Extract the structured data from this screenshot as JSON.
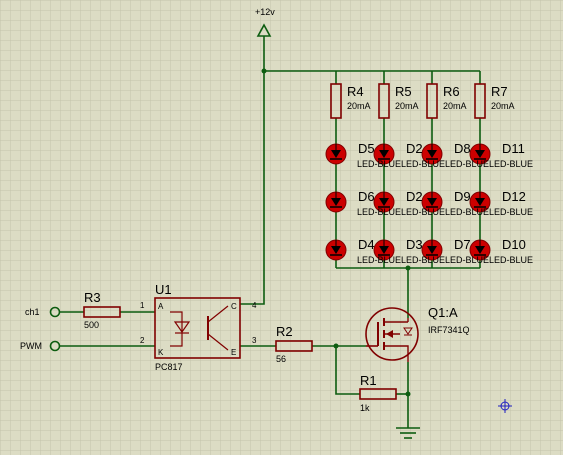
{
  "supply": {
    "label": "+12v"
  },
  "resistors_top": [
    {
      "name": "R4",
      "value": "20mA"
    },
    {
      "name": "R5",
      "value": "20mA"
    },
    {
      "name": "R6",
      "value": "20mA"
    },
    {
      "name": "R7",
      "value": "20mA"
    }
  ],
  "led_rows": [
    {
      "labels": [
        "D5",
        "D2",
        "D8",
        "D11"
      ],
      "type": "LED-BLUE",
      "overlap_text": "LED-BLUELED-BLUELED-BLUELED-BLUE"
    },
    {
      "labels": [
        "D6",
        "D2",
        "D9",
        "D12"
      ],
      "type": "LED-BLUE",
      "overlap_text": "LED-BLUELED-BLUELED-BLUELED-BLUE"
    },
    {
      "labels": [
        "D4",
        "D3",
        "D7",
        "D10"
      ],
      "type": "LED-BLUE",
      "overlap_text": "LED-BLUELED-BLUELED-BLUELED-BLUE"
    }
  ],
  "inputs": {
    "ch1": "ch1",
    "pwm": "PWM"
  },
  "r3": {
    "name": "R3",
    "value": "500"
  },
  "u1": {
    "name": "U1",
    "part": "PC817",
    "pins": [
      "1",
      "2",
      "3",
      "4"
    ],
    "letters": [
      "A",
      "K",
      "C",
      "E"
    ]
  },
  "r2": {
    "name": "R2",
    "value": "56"
  },
  "q1": {
    "name": "Q1:A",
    "part": "IRF7341Q"
  },
  "r1": {
    "name": "R1",
    "value": "1k"
  },
  "colors": {
    "background": "#dcdcc4",
    "grid": "#c4c4ac",
    "wire": "#0d5c10",
    "component": "#800000",
    "led_fill": "#cc0000",
    "junction": "#0d5c10"
  }
}
